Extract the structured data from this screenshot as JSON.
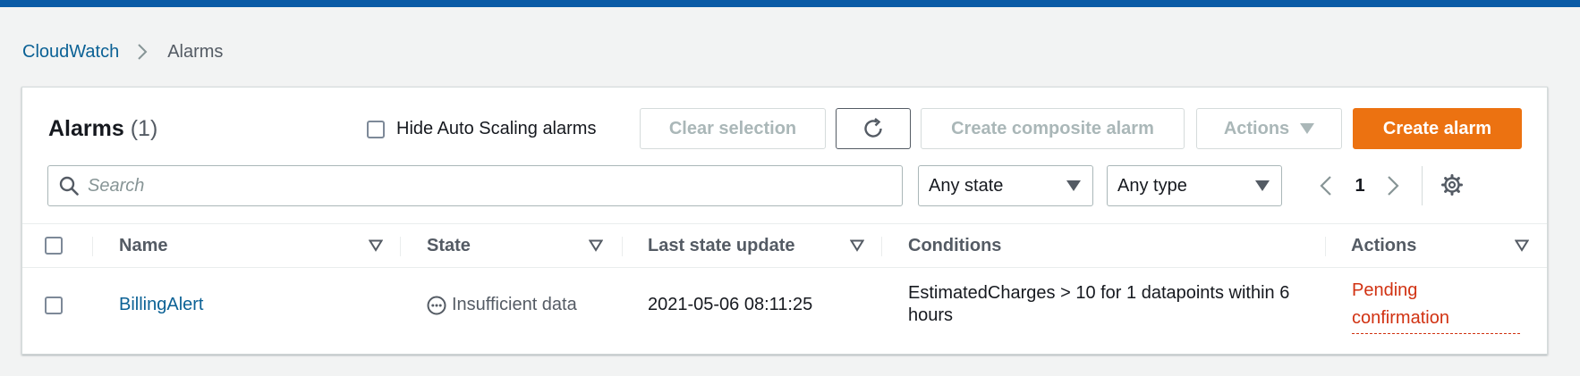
{
  "breadcrumb": {
    "root": "CloudWatch",
    "current": "Alarms"
  },
  "header": {
    "title": "Alarms",
    "count": "(1)"
  },
  "toolbar": {
    "hide_autoscaling_label": "Hide Auto Scaling alarms",
    "clear_selection": "Clear selection",
    "create_composite": "Create composite alarm",
    "actions": "Actions",
    "create_alarm": "Create alarm"
  },
  "filters": {
    "search_placeholder": "Search",
    "state_value": "Any state",
    "type_value": "Any type"
  },
  "pagination": {
    "page": "1"
  },
  "table": {
    "columns": [
      "Name",
      "State",
      "Last state update",
      "Conditions",
      "Actions"
    ],
    "rows": [
      {
        "name": "BillingAlert",
        "state": "Insufficient data",
        "last_update": "2021-05-06 08:11:25",
        "conditions": "EstimatedCharges > 10 for 1 datapoints within 6 hours",
        "actions_line1": "Pending",
        "actions_line2": "confirmation"
      }
    ]
  },
  "colors": {
    "top_bar": "#0a5ba6",
    "link": "#0b6195",
    "primary_button": "#ec7211",
    "pending": "#d13212"
  }
}
